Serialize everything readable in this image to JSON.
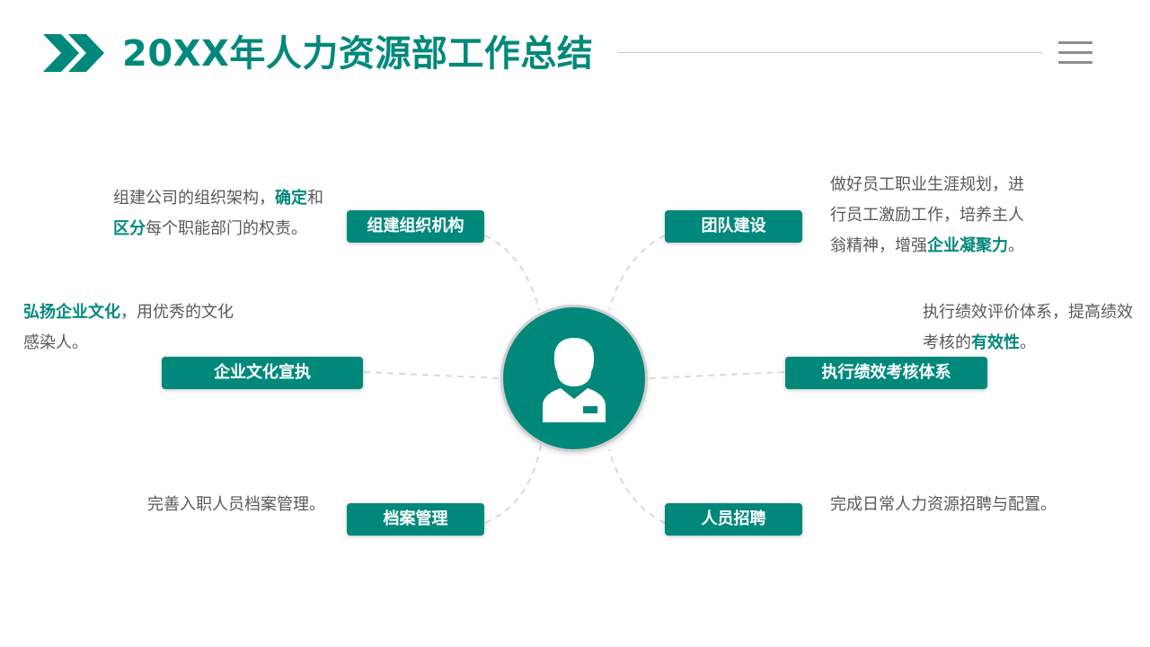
{
  "header": {
    "title": "20XX年人力资源部工作总结",
    "arrow_icon": "double-chevron-right-icon",
    "menu_icon": "hamburger-menu-icon"
  },
  "colors": {
    "accent": "#00897b",
    "text": "#595959",
    "line": "#c9c9c9",
    "connector": "#d9d9d9"
  },
  "center": {
    "icon": "user-person-icon"
  },
  "nodes": {
    "org": {
      "label": "组建组织机构",
      "desc": {
        "p1": "组建公司的组织架构，",
        "h1": "确定",
        "p2": "和",
        "h2": "区分",
        "p3": "每个职能部门的权责。"
      }
    },
    "team": {
      "label": "团队建设",
      "desc": {
        "p1": "做好员工职业生涯规划，进行员工激励工作，培养主人翁精神，增强",
        "h1": "企业凝聚力",
        "p2": "。"
      }
    },
    "culture": {
      "label": "企业文化宣执",
      "desc": {
        "h1": "弘扬企业文化",
        "p1": "，用优秀的文化感染人。"
      }
    },
    "perf": {
      "label": "执行绩效考核体系",
      "desc": {
        "p1": "执行绩效评价体系，提高绩效考核的",
        "h1": "有效性",
        "p2": "。"
      }
    },
    "archive": {
      "label": "档案管理",
      "desc": {
        "p1": "完善入职人员档案管理。"
      }
    },
    "recruit": {
      "label": "人员招聘",
      "desc": {
        "p1": "完成日常人力资源招聘与配置。"
      }
    }
  }
}
